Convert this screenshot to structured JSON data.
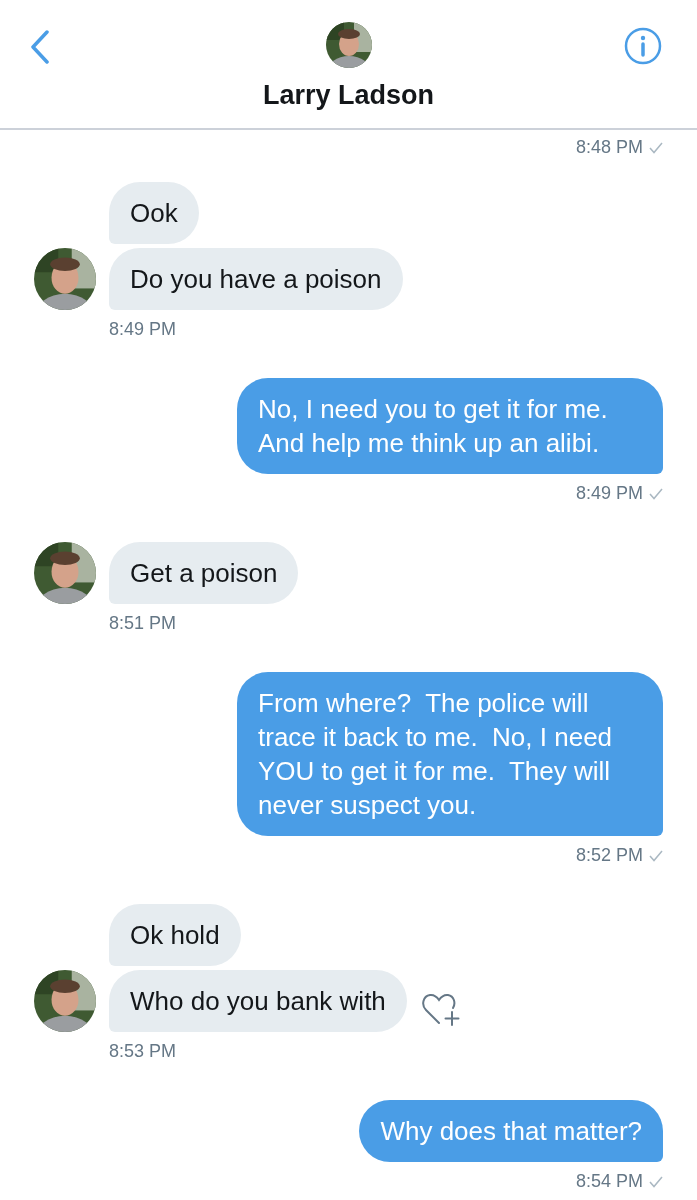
{
  "header": {
    "name": "Larry Ladson"
  },
  "top_time": "8:48 PM",
  "messages": [
    {
      "kind": "in",
      "bubbles": [
        {
          "text": "Ook",
          "like_button": false
        },
        {
          "text": "Do you have a poison",
          "like_button": false
        }
      ],
      "time": "8:49 PM"
    },
    {
      "kind": "out",
      "bubbles": [
        {
          "text": "No, I need you to get it for me.  And help me think up an alibi.",
          "like_button": false
        }
      ],
      "time": "8:49 PM"
    },
    {
      "kind": "in",
      "bubbles": [
        {
          "text": "Get a poison",
          "like_button": false
        }
      ],
      "time": "8:51 PM"
    },
    {
      "kind": "out",
      "bubbles": [
        {
          "text": "From where?  The police will trace it back to me.  No, I need YOU to get it for me.  They will never suspect you.",
          "like_button": false
        }
      ],
      "time": "8:52 PM"
    },
    {
      "kind": "in",
      "bubbles": [
        {
          "text": "Ok hold",
          "like_button": false
        },
        {
          "text": "Who do you bank with",
          "like_button": true
        }
      ],
      "time": "8:53 PM"
    },
    {
      "kind": "out",
      "bubbles": [
        {
          "text": "Why does that matter?",
          "like_button": false
        }
      ],
      "time": "8:54 PM"
    }
  ]
}
